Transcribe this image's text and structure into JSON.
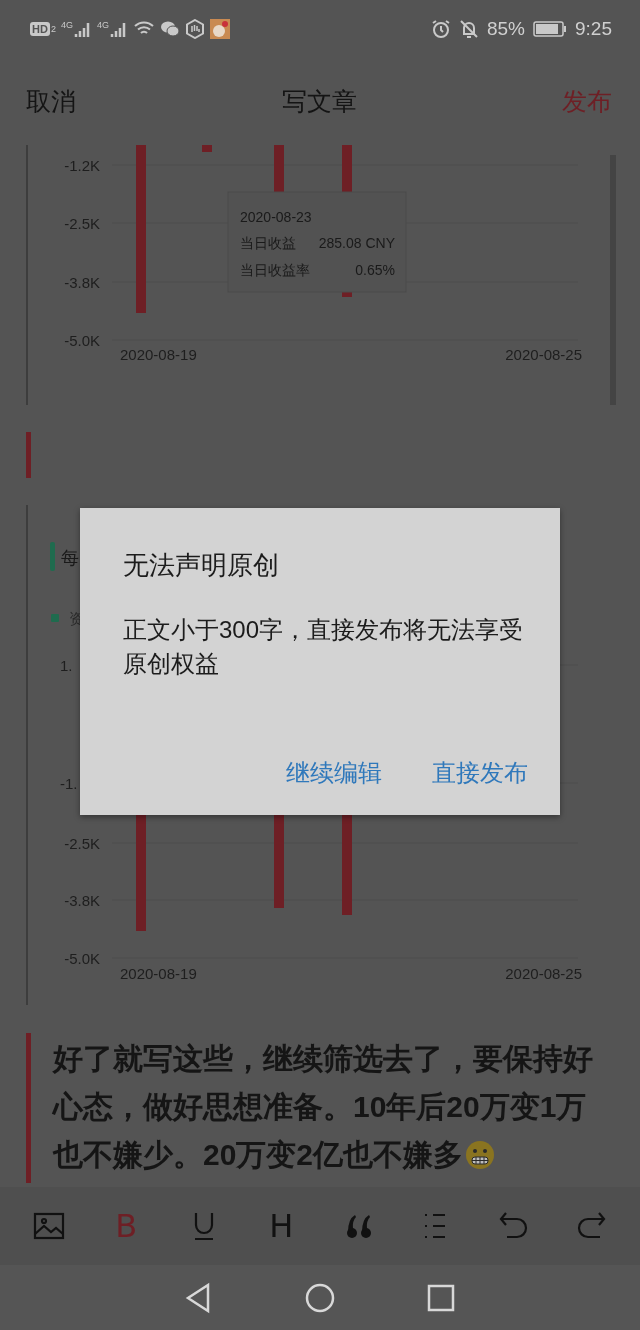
{
  "status_bar": {
    "hd": "HD",
    "sim": "2",
    "networks": [
      "4G",
      "4G"
    ],
    "battery": "85%",
    "time": "9:25"
  },
  "header": {
    "cancel": "取消",
    "title": "写文章",
    "publish": "发布"
  },
  "charts": [
    {
      "y_ticks": [
        "-1.2K",
        "-2.5K",
        "-3.8K",
        "-5.0K"
      ],
      "x_ticks": [
        "2020-08-19",
        "2020-08-25"
      ],
      "tooltip": {
        "date": "2020-08-23",
        "rows": [
          {
            "label": "当日收益",
            "value": "285.08 CNY"
          },
          {
            "label": "当日收益率",
            "value": "0.65%"
          }
        ]
      }
    },
    {
      "title": "每",
      "legend": "资",
      "y_ticks": [
        "1.",
        "-1.",
        "-2.5K",
        "-3.8K",
        "-5.0K"
      ],
      "x_ticks": [
        "2020-08-19",
        "2020-08-25"
      ]
    }
  ],
  "paragraph": "好了就写这些，继续筛选去了，要保持好心态，做好思想准备。10年后20万变1万也不嫌少。20万变2亿也不嫌多",
  "toolbar": [
    {
      "kind": "image",
      "selected": false
    },
    {
      "kind": "bold",
      "label": "B",
      "selected": true
    },
    {
      "kind": "underline",
      "selected": false
    },
    {
      "kind": "heading",
      "label": "H",
      "selected": false
    },
    {
      "kind": "quote",
      "selected": false
    },
    {
      "kind": "list",
      "selected": false
    },
    {
      "kind": "undo",
      "selected": false
    },
    {
      "kind": "redo",
      "selected": false
    }
  ],
  "dialog": {
    "title": "无法声明原创",
    "message": "正文小于300字，直接发布将无法享受原创权益",
    "buttons": [
      "继续编辑",
      "直接发布"
    ]
  }
}
